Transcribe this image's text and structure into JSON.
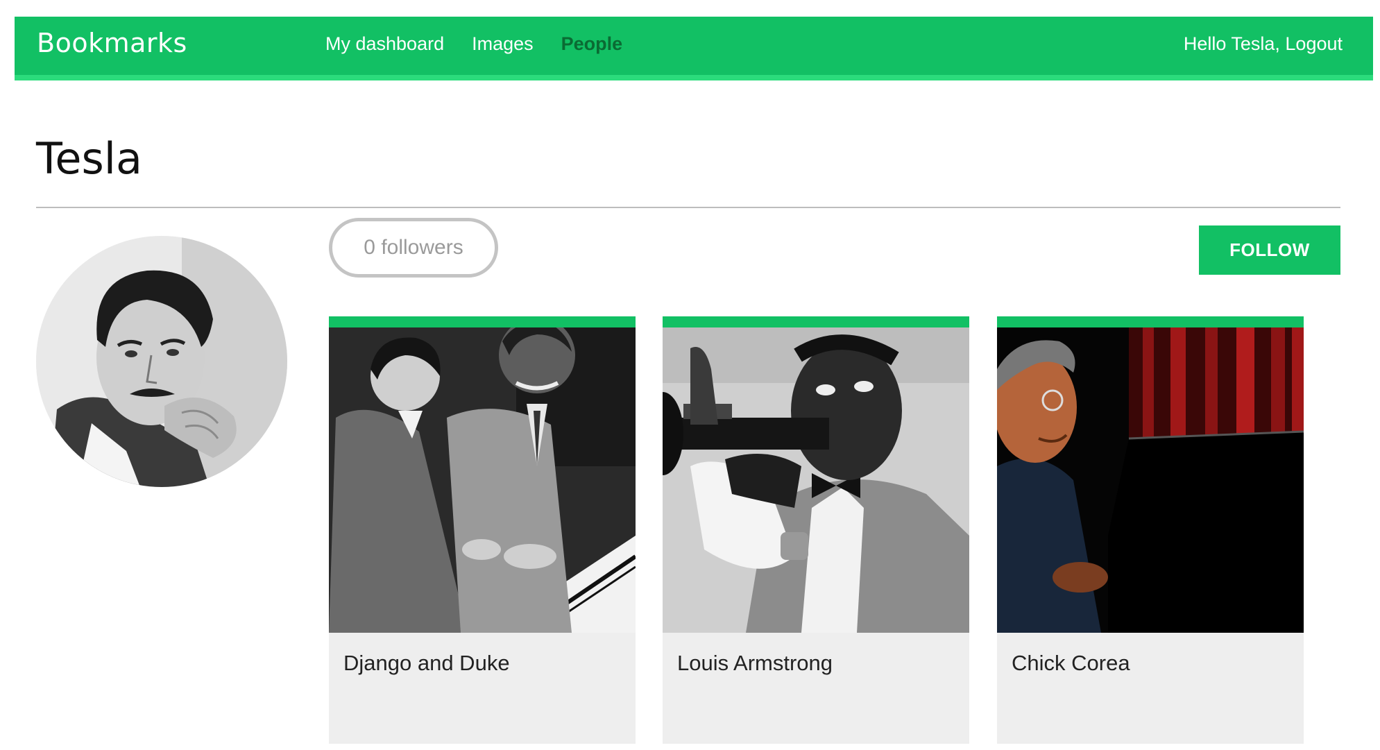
{
  "header": {
    "brand": "Bookmarks",
    "nav": [
      {
        "label": "My dashboard",
        "active": false
      },
      {
        "label": "Images",
        "active": false
      },
      {
        "label": "People",
        "active": true
      }
    ],
    "greeting": "Hello Tesla, ",
    "logout_label": "Logout"
  },
  "profile": {
    "name": "Tesla",
    "followers_label": "0 followers",
    "follow_label": "FOLLOW"
  },
  "images": [
    {
      "title": "Django and Duke"
    },
    {
      "title": "Louis Armstrong"
    },
    {
      "title": "Chick Corea"
    }
  ],
  "colors": {
    "brand": "#12c064",
    "brand_light": "#2bdc7c",
    "active_nav": "#0a6b33",
    "card_bg": "#eeeeee"
  }
}
